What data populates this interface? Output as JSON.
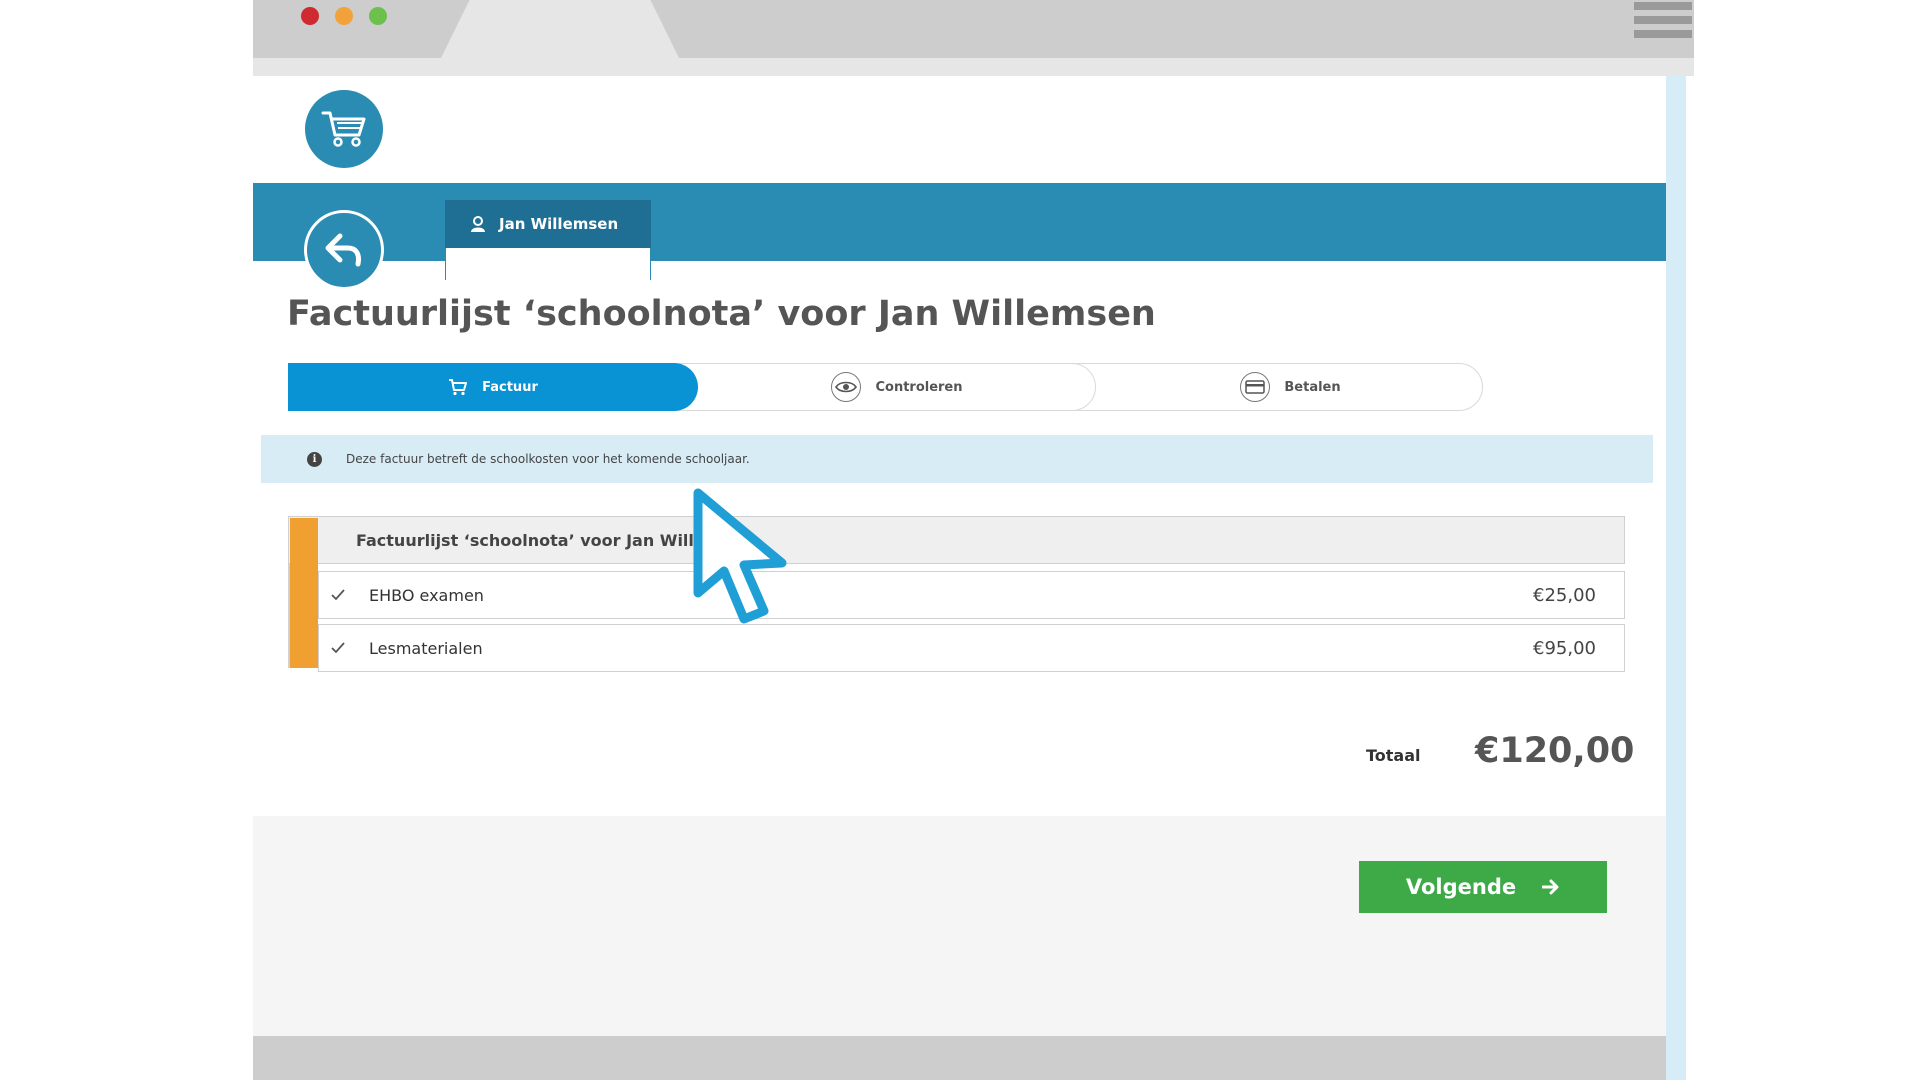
{
  "user_tab": {
    "name": "Jan Willemsen"
  },
  "page": {
    "title": "Factuurlijst ‘schoolnota’ voor Jan Willemsen"
  },
  "stepper": {
    "steps": [
      {
        "label": "Factuur",
        "icon": "cart-icon",
        "active": true
      },
      {
        "label": "Controleren",
        "icon": "eye-icon",
        "active": false
      },
      {
        "label": "Betalen",
        "icon": "card-icon",
        "active": false
      }
    ]
  },
  "info": {
    "text": "Deze factuur betreft de schoolkosten voor het komende schooljaar."
  },
  "invoice": {
    "heading": "Factuurlijst ‘schoolnota’ voor Jan Willem",
    "items": [
      {
        "label": "EHBO examen",
        "amount": "€25,00",
        "checked": true
      },
      {
        "label": "Lesmaterialen",
        "amount": "€95,00",
        "checked": true
      }
    ],
    "accent_color": "#f0a030"
  },
  "total": {
    "label": "Totaal",
    "value": "€120,00"
  },
  "actions": {
    "next_label": "Volgende"
  },
  "colors": {
    "brand_blue": "#2a8bb3",
    "active_step": "#0a93d4",
    "next_button": "#3daa47",
    "info_background": "#d8ecf6"
  }
}
